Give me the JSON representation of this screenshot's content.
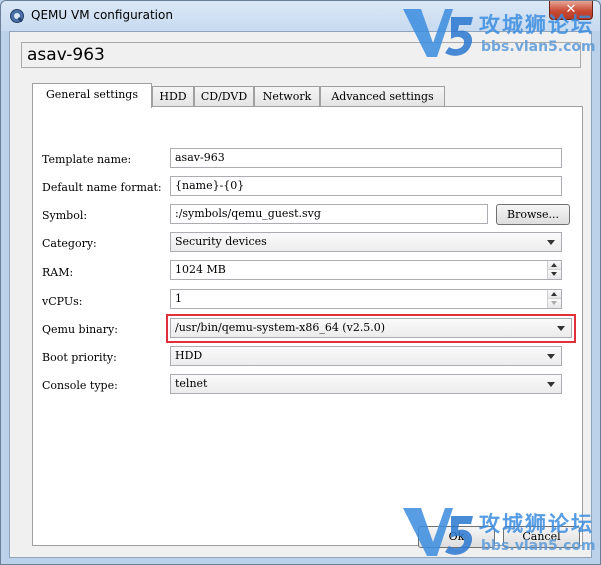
{
  "window": {
    "title": "QEMU VM configuration",
    "close_glyph": "✕"
  },
  "vm_name": "asav-963",
  "tabs": [
    {
      "label": "General settings",
      "active": true
    },
    {
      "label": "HDD",
      "active": false
    },
    {
      "label": "CD/DVD",
      "active": false
    },
    {
      "label": "Network",
      "active": false
    },
    {
      "label": "Advanced settings",
      "active": false
    }
  ],
  "form": {
    "template_name": {
      "label": "Template name:",
      "value": "asav-963"
    },
    "default_name_format": {
      "label": "Default name format:",
      "value": "{name}-{0}"
    },
    "symbol": {
      "label": "Symbol:",
      "value": ":/symbols/qemu_guest.svg",
      "browse_label": "Browse..."
    },
    "category": {
      "label": "Category:",
      "value": "Security devices"
    },
    "ram": {
      "label": "RAM:",
      "value": "1024 MB"
    },
    "vcpus": {
      "label": "vCPUs:",
      "value": "1"
    },
    "qemu_binary": {
      "label": "Qemu binary:",
      "value": "/usr/bin/qemu-system-x86_64 (v2.5.0)",
      "highlight_color": "#e0303a"
    },
    "boot_priority": {
      "label": "Boot priority:",
      "value": "HDD"
    },
    "console_type": {
      "label": "Console type:",
      "value": "telnet"
    }
  },
  "buttons": {
    "ok": "Ok",
    "cancel": "Cancel"
  },
  "watermark": {
    "text": "攻城狮论坛",
    "url": "bbs.vlan5.com",
    "color": "#3b8de0"
  }
}
